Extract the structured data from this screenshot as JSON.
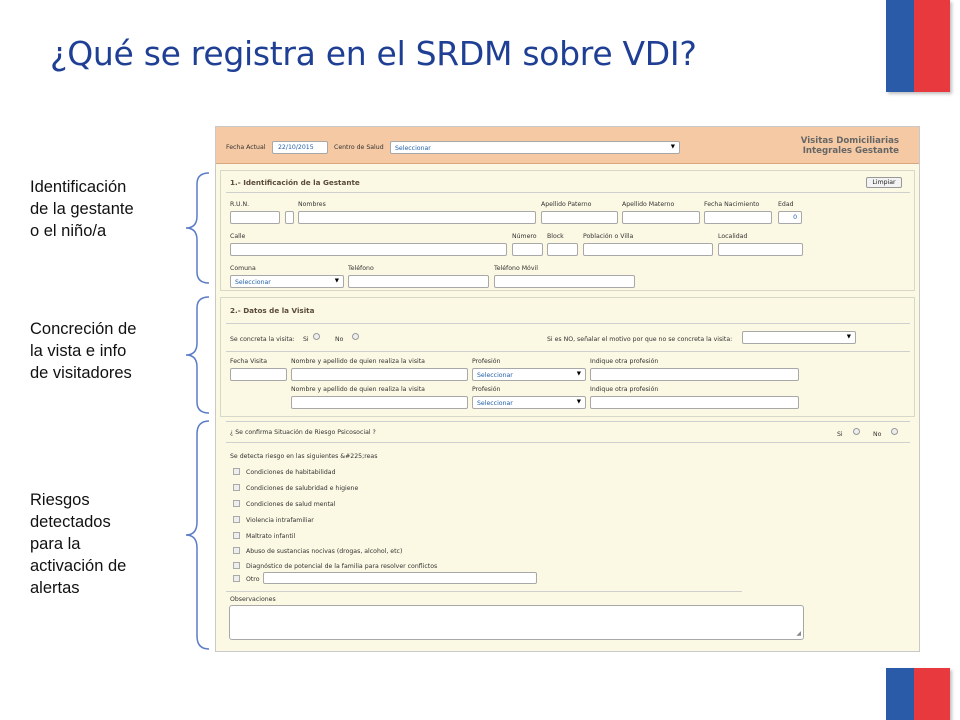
{
  "slide": {
    "title": "¿Qué se registra en el SRDM sobre VDI?",
    "labels": {
      "identificacion": [
        "Identificación",
        "de la gestante",
        "o el niño/a"
      ],
      "concrecion": [
        "Concreción de",
        "la vista e info",
        "de visitadores"
      ],
      "riesgos": [
        "Riesgos",
        "detectados",
        "para la",
        "activación de",
        "alertas"
      ]
    },
    "colors": {
      "title": "#1f3f95",
      "flag_blue": "#2a5ba8",
      "flag_red": "#e8393f"
    }
  },
  "app": {
    "header": {
      "fecha_actual_label": "Fecha Actual",
      "fecha_actual_value": "22/10/2015",
      "centro_label": "Centro de Salud",
      "centro_value": "Seleccionar",
      "title_line1": "Visitas Domiciliarias",
      "title_line2": "Integrales Gestante"
    },
    "section1": {
      "title": "1.- Identificación de la Gestante",
      "limpiar": "Limpiar",
      "run": "R.U.N.",
      "nombres": "Nombres",
      "apellido_paterno": "Apellido Paterno",
      "apellido_materno": "Apellido Materno",
      "fecha_nacimiento": "Fecha Nacimiento",
      "edad": "Edad",
      "edad_value": "0",
      "calle": "Calle",
      "numero": "Número",
      "block": "Block",
      "poblacion": "Población o Villa",
      "localidad": "Localidad",
      "comuna": "Comuna",
      "comuna_value": "Seleccionar",
      "telefono": "Teléfono",
      "telefono_movil": "Teléfono Móvil"
    },
    "section2": {
      "title": "2.- Datos de la Visita",
      "concreta_label": "Se concreta la visita:",
      "si": "Si",
      "no": "No",
      "motivo_label": "Si es NO, señalar el motivo por que no se concreta la visita:",
      "fecha_visita": "Fecha Visita",
      "nombre_visitador": "Nombre y apellido de quien realiza la visita",
      "profesion": "Profesión",
      "profesion_value": "Seleccionar",
      "otra_profesion": "Indique otra profesión"
    },
    "section3": {
      "confirma_label": "¿ Se confirma Situación de Riesgo Psicosocial ?",
      "si": "Si",
      "no": "No",
      "detecta_label": "Se detecta riesgo en las siguientes &#225;reas",
      "riesgos": [
        "Condiciones de habitabilidad",
        "Condiciones de salubridad e higiene",
        "Condiciones de salud mental",
        "Violencia intrafamiliar",
        "Maltrato infantil",
        "Abuso de sustancias nocivas (drogas, alcohol, etc)",
        "Diagnóstico de potencial de la familia para resolver conflictos"
      ],
      "otro": "Otro",
      "observaciones": "Observaciones"
    }
  }
}
